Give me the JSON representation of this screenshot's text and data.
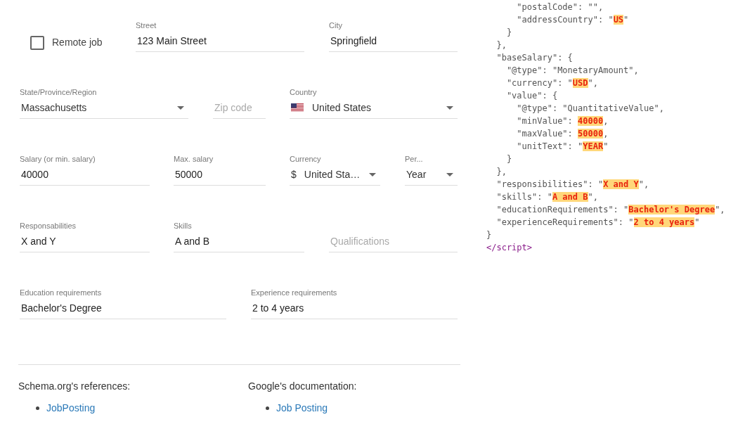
{
  "form": {
    "rows": [
      [
        {
          "kind": "checkbox",
          "label": "Remote job",
          "checked": false
        },
        {
          "kind": "text",
          "label": "Street",
          "value": "123 Main Street"
        },
        {
          "kind": "text",
          "label": "City",
          "value": "Springfield"
        }
      ],
      [
        {
          "kind": "select",
          "label": "State/Province/Region",
          "value": "Massachusetts"
        },
        {
          "kind": "text",
          "placeholder": "Zip code"
        },
        {
          "kind": "flag-select",
          "label": "Country",
          "value": "United States"
        }
      ],
      [
        {
          "kind": "text",
          "label": "Salary (or min. salary)",
          "value": "40000"
        },
        {
          "kind": "text",
          "label": "Max. salary",
          "value": "50000"
        },
        {
          "kind": "select",
          "label": "Currency",
          "value": "United Sta…",
          "prefix": "$"
        },
        {
          "kind": "select",
          "label": "Per...",
          "value": "Year"
        }
      ],
      [
        {
          "kind": "text",
          "label": "Responsabilities",
          "value": "X and Y"
        },
        {
          "kind": "text",
          "label": "Skills",
          "value": "A and B"
        },
        {
          "kind": "text",
          "placeholder": "Qualifications"
        }
      ],
      [
        {
          "kind": "text",
          "label": "Education requirements",
          "value": "Bachelor's Degree"
        },
        {
          "kind": "text",
          "label": "Experience requirements",
          "value": "2 to 4 years"
        }
      ]
    ]
  },
  "references": [
    {
      "heading": "Schema.org's references:",
      "links": [
        "JobPosting"
      ]
    },
    {
      "heading": "Google's documentation:",
      "links": [
        "Job Posting"
      ]
    }
  ],
  "code": [
    [
      {
        "kind": "plain",
        "text": "      \"postalCode\": \"\","
      }
    ],
    [
      {
        "kind": "plain",
        "text": "      \"addressCountry\": \""
      },
      {
        "kind": "highlight",
        "text": "US"
      },
      {
        "kind": "plain",
        "text": "\""
      }
    ],
    [
      {
        "kind": "plain",
        "text": "    }"
      }
    ],
    [
      {
        "kind": "plain",
        "text": "  },"
      }
    ],
    [
      {
        "kind": "plain",
        "text": "  \"baseSalary\": {"
      }
    ],
    [
      {
        "kind": "plain",
        "text": "    \"@type\": \"MonetaryAmount\","
      }
    ],
    [
      {
        "kind": "plain",
        "text": "    \"currency\": \""
      },
      {
        "kind": "highlight",
        "text": "USD"
      },
      {
        "kind": "plain",
        "text": "\","
      }
    ],
    [
      {
        "kind": "plain",
        "text": "    \"value\": {"
      }
    ],
    [
      {
        "kind": "plain",
        "text": "      \"@type\": \"QuantitativeValue\","
      }
    ],
    [
      {
        "kind": "plain",
        "text": "      \"minValue\": "
      },
      {
        "kind": "highlight",
        "text": "40000"
      },
      {
        "kind": "plain",
        "text": ","
      }
    ],
    [
      {
        "kind": "plain",
        "text": "      \"maxValue\": "
      },
      {
        "kind": "highlight",
        "text": "50000"
      },
      {
        "kind": "plain",
        "text": ","
      }
    ],
    [
      {
        "kind": "plain",
        "text": "      \"unitText\": \""
      },
      {
        "kind": "highlight",
        "text": "YEAR"
      },
      {
        "kind": "plain",
        "text": "\""
      }
    ],
    [
      {
        "kind": "plain",
        "text": "    }"
      }
    ],
    [
      {
        "kind": "plain",
        "text": "  },"
      }
    ],
    [
      {
        "kind": "plain",
        "text": "  \"responsibilities\": \""
      },
      {
        "kind": "highlight",
        "text": "X and Y"
      },
      {
        "kind": "plain",
        "text": "\","
      }
    ],
    [
      {
        "kind": "plain",
        "text": "  \"skills\": \""
      },
      {
        "kind": "highlight",
        "text": "A and B"
      },
      {
        "kind": "plain",
        "text": "\","
      }
    ],
    [
      {
        "kind": "plain",
        "text": "  \"educationRequirements\": \""
      },
      {
        "kind": "highlight",
        "text": "Bachelor's Degree"
      },
      {
        "kind": "plain",
        "text": "\","
      }
    ],
    [
      {
        "kind": "plain",
        "text": "  \"experienceRequirements\": \""
      },
      {
        "kind": "highlight",
        "text": "2 to 4 years"
      },
      {
        "kind": "plain",
        "text": "\""
      }
    ],
    [
      {
        "kind": "plain",
        "text": "}"
      }
    ],
    [
      {
        "kind": "tag",
        "text": "</script>"
      }
    ]
  ]
}
